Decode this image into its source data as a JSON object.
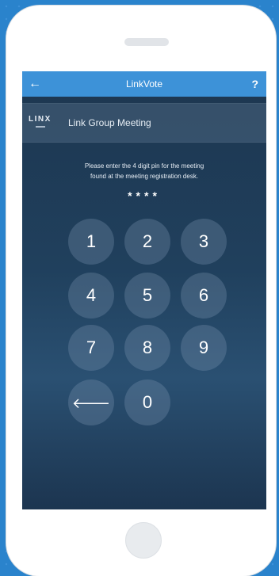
{
  "app": {
    "title": "LinkVote",
    "back_icon": "arrow-left-icon",
    "help_label": "?"
  },
  "meeting": {
    "logo_text": "LINX",
    "name": "Link Group Meeting"
  },
  "instructions": {
    "line1": "Please enter the 4 digit pin for the meeting",
    "line2": "found at the meeting registration desk."
  },
  "pin": {
    "masked": "****"
  },
  "keypad": {
    "k1": "1",
    "k2": "2",
    "k3": "3",
    "k4": "4",
    "k5": "5",
    "k6": "6",
    "k7": "7",
    "k8": "8",
    "k9": "9",
    "k0": "0",
    "backspace": "🡐"
  },
  "colors": {
    "page_background": "#2a83cc",
    "top_bar": "#3d92d8",
    "screen_background": "#20405d"
  }
}
